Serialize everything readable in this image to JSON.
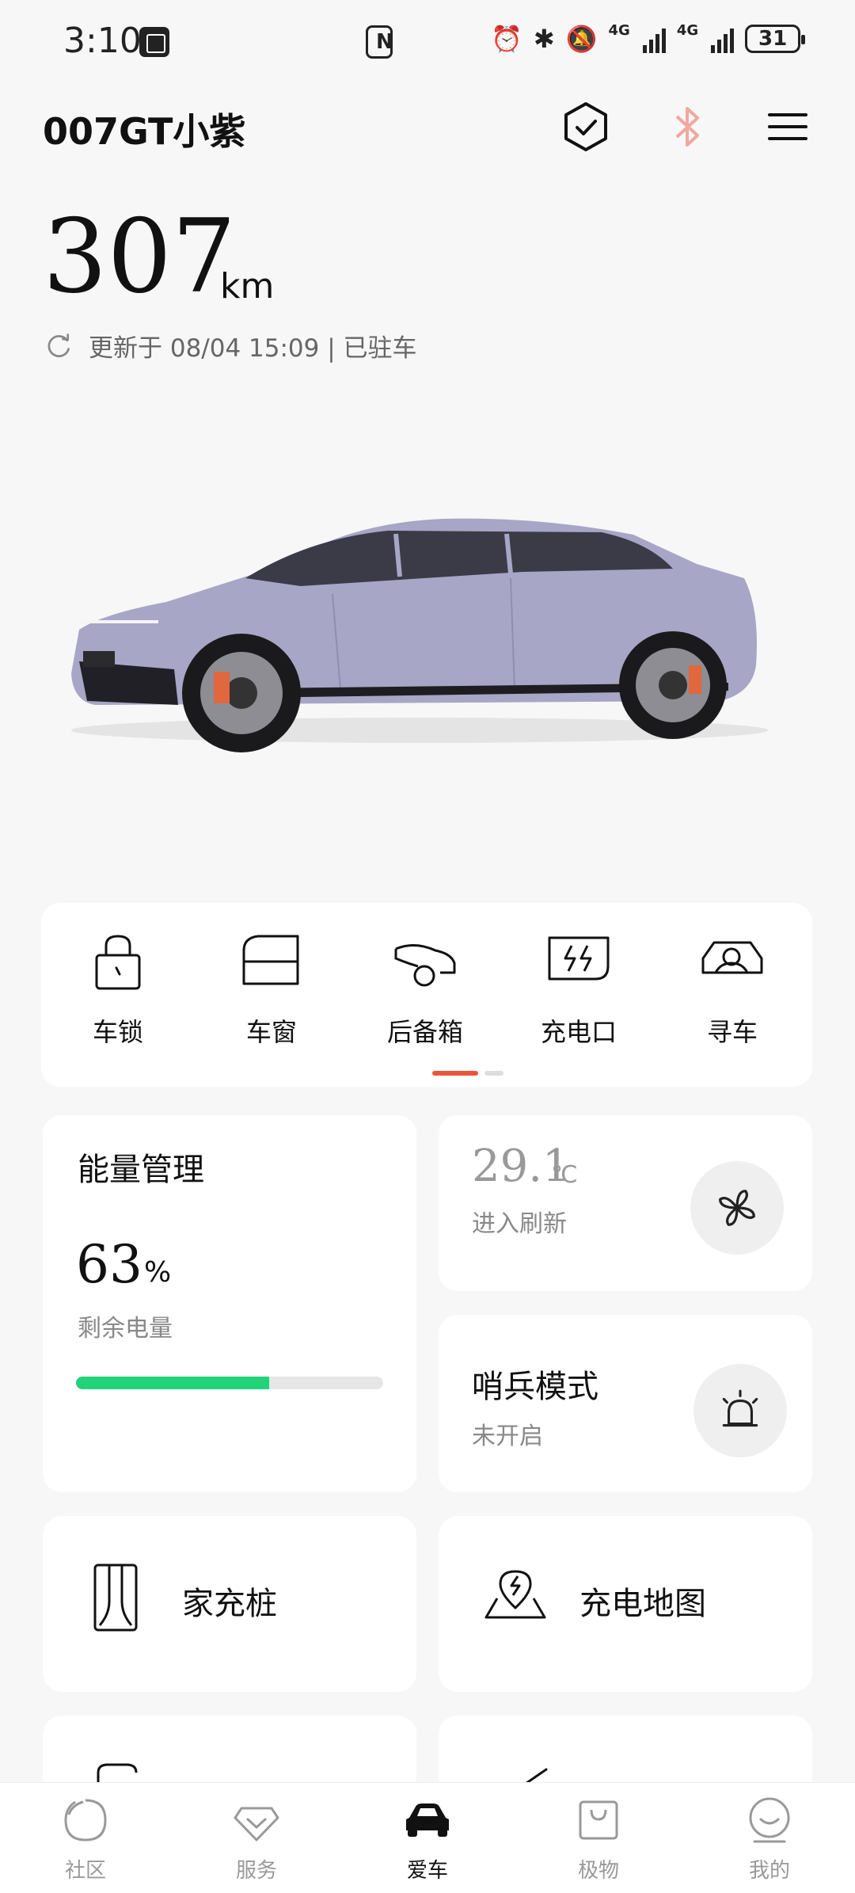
{
  "status_bar": {
    "time": "3:10",
    "network_1": "4G",
    "network_2": "4G",
    "battery": "31"
  },
  "header": {
    "vehicle_name": "007GT小紫"
  },
  "range": {
    "value": "307",
    "unit": "km",
    "updated": "更新于 08/04 15:09 | 已驻车"
  },
  "quick_controls": {
    "items": [
      {
        "label": "车锁",
        "icon": "lock-icon"
      },
      {
        "label": "车窗",
        "icon": "window-icon"
      },
      {
        "label": "后备箱",
        "icon": "trunk-icon"
      },
      {
        "label": "充电口",
        "icon": "charge-port-icon"
      },
      {
        "label": "寻车",
        "icon": "find-car-icon"
      }
    ]
  },
  "energy": {
    "title": "能量管理",
    "percent": "63",
    "percent_unit": "%",
    "label": "剩余电量",
    "fill_fraction": 0.63,
    "fill_color": "#22d37a"
  },
  "climate": {
    "temperature": "29.1",
    "temp_unit": "℃",
    "status": "进入刷新"
  },
  "sentry": {
    "title": "哨兵模式",
    "status": "未开启"
  },
  "tiles": {
    "home_charger": "家充桩",
    "charge_map": "充电地图"
  },
  "bottom_nav": {
    "items": [
      {
        "label": "社区",
        "active": false
      },
      {
        "label": "服务",
        "active": false
      },
      {
        "label": "爱车",
        "active": true
      },
      {
        "label": "极物",
        "active": false
      },
      {
        "label": "我的",
        "active": false
      }
    ]
  },
  "colors": {
    "accent_indicator": "#e8553a",
    "bluetooth": "#f0a8a0"
  }
}
